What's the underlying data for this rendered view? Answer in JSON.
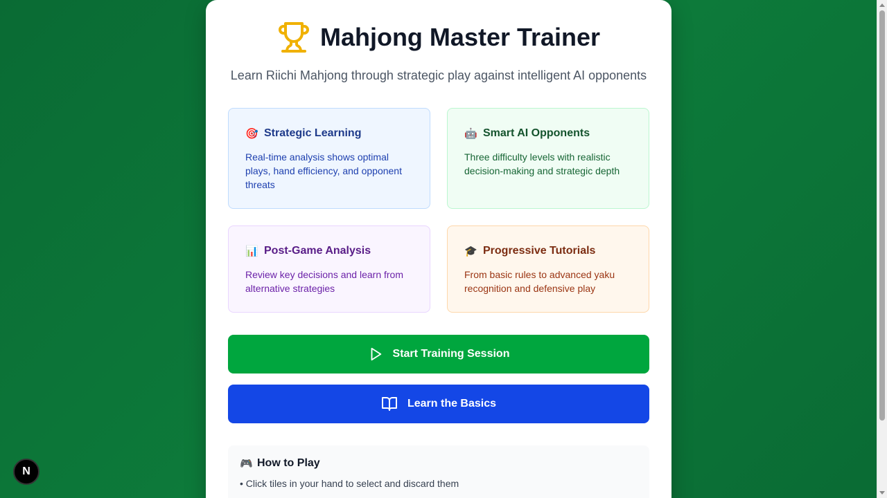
{
  "header": {
    "title": "Mahjong Master Trainer",
    "subtitle": "Learn Riichi Mahjong through strategic play against intelligent AI opponents",
    "icon": "trophy-icon",
    "icon_color": "#f0b100"
  },
  "features": [
    {
      "emoji": "🎯",
      "title": "Strategic Learning",
      "desc": "Real-time analysis shows optimal plays, hand efficiency, and opponent threats"
    },
    {
      "emoji": "🤖",
      "title": "Smart AI Opponents",
      "desc": "Three difficulty levels with realistic decision-making and strategic depth"
    },
    {
      "emoji": "📊",
      "title": "Post-Game Analysis",
      "desc": "Review key decisions and learn from alternative strategies"
    },
    {
      "emoji": "🎓",
      "title": "Progressive Tutorials",
      "desc": "From basic rules to advanced yaku recognition and defensive play"
    }
  ],
  "buttons": {
    "start_label": "Start Training Session",
    "learn_label": "Learn the Basics",
    "start_color": "#00a63e",
    "learn_color": "#1447e6"
  },
  "how_to_play": {
    "emoji": "🎮",
    "title": "How to Play",
    "items": [
      "• Click tiles in your hand to select and discard them"
    ]
  },
  "badge": {
    "label": "N"
  },
  "colors": {
    "background": "#0a6b34"
  }
}
